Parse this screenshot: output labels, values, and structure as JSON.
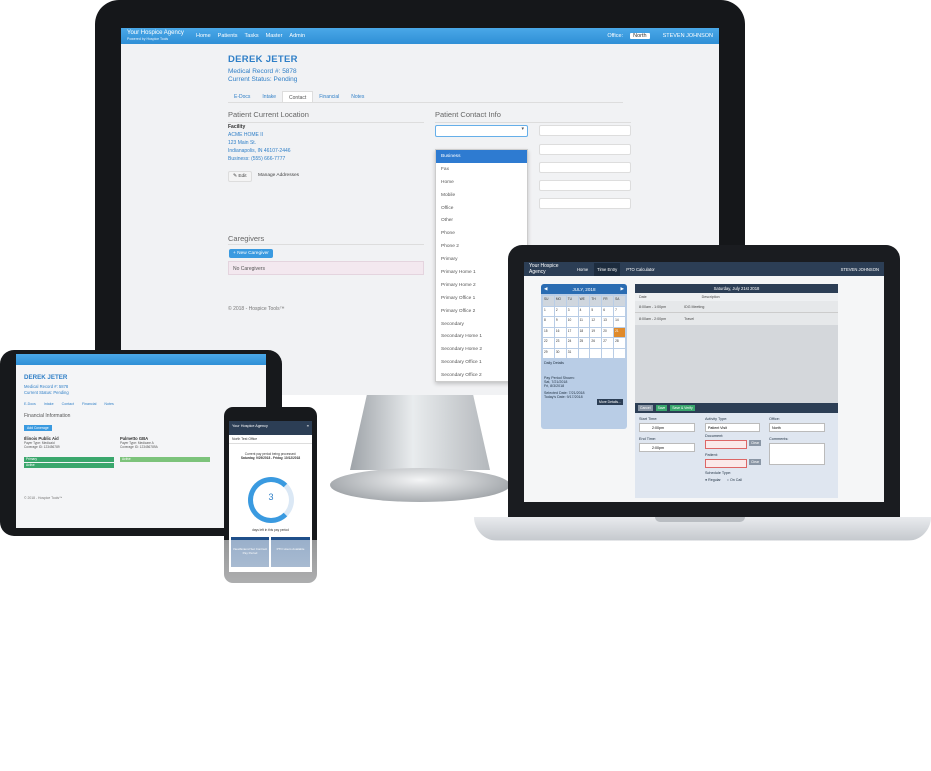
{
  "monitor": {
    "nav": {
      "brand": "Your Hospice Agency",
      "powered": "Powered by Hospice Tools",
      "home": "Home",
      "patients": "Patients",
      "tasks": "Tasks",
      "master": "Master",
      "admin": "Admin",
      "office_label": "Office:",
      "office_value": "North",
      "user": "STEVEN JOHNSON"
    },
    "patient_name": "DEREK JETER",
    "record": "Medical Record #: 5878",
    "status": "Current Status: Pending",
    "tabs": [
      "E-Docs",
      "Intake",
      "Contact",
      "Financial",
      "Notes"
    ],
    "location_title": "Patient Current Location",
    "facility_label": "Facility",
    "facility_lines": [
      "ACME HOME II",
      "123 Main St.",
      "Indianapolis, IN 46107-2446",
      "Business: (555) 666-7777"
    ],
    "edit": "Edit",
    "manage": "Manage Addresses",
    "contact_title": "Patient Contact Info",
    "phone_types": [
      "Business",
      "Fax",
      "Home",
      "Mobile",
      "Office",
      "Other",
      "Phone",
      "Phone 2",
      "Primary",
      "Primary Home 1",
      "Primary Home 2",
      "Primary Office 1",
      "Primary Office 2",
      "Secondary",
      "Secondary Home 1",
      "Secondary Home 2",
      "Secondary Office 1",
      "Secondary Office 2"
    ],
    "caregivers_title": "Caregivers",
    "new_caregiver": "New Caregiver",
    "no_caregivers": "No Caregivers",
    "footer": "© 2018 - Hospice Tools™"
  },
  "tablet": {
    "name": "DEREK JETER",
    "record": "Medical Record #: 5878",
    "status": "Current Status: Pending",
    "tabs": [
      "E-Docs",
      "Intake",
      "Contact",
      "Financial",
      "Notes"
    ],
    "section": "Financial Information",
    "add": "Add Coverage",
    "cards": [
      {
        "title": "Illinois Public Aid",
        "lines": [
          "Payer Type: Medicaid",
          "Coverage ID: 123456789"
        ],
        "bars": [
          "Primary",
          "Active"
        ]
      },
      {
        "title": "Palmetto GBA",
        "lines": [
          "Payer Type: Medicare A",
          "Coverage ID: 123456789A"
        ],
        "bars": [
          "Active"
        ]
      }
    ],
    "footer": "© 2018 - Hospice Tools™"
  },
  "phone": {
    "brand": "Your Hospice Agency",
    "office": "North Test Office",
    "period_text": "Current pay period being processed:",
    "period": "Saturday, 9/29/2018 - Friday, 10/12/2018",
    "days": "3",
    "days_label": "days left in this pay period",
    "btn1": "View/Extend Set Contract Pay Period",
    "btn2": "PTO Hours Available"
  },
  "laptop": {
    "brand": "Your Hospice Agency",
    "home": "Home",
    "time_entry": "Time Entry",
    "pto": "PTO Calculator",
    "user": "STEVEN JOHNSON",
    "month": "JULY, 2018",
    "weekdays": [
      "SU",
      "MO",
      "TU",
      "WE",
      "TH",
      "FR",
      "SA"
    ],
    "daily_details": "Daily Details",
    "pay_period_shown": "Pay Period Shown:",
    "pp_start": "Sat, 7/21/2018",
    "pp_end": "Fri, 8/3/2018",
    "more": "More Details...",
    "selected_date": "Selected Date: 7/21/2018",
    "todays_date": "Today's Date: 9/17/2018",
    "day_title": "Saturday, July 21st 2018",
    "col_date": "Date",
    "col_desc": "Description",
    "rows": [
      {
        "time": "8:00am - 1:00pm",
        "desc": "IDG Meeting"
      },
      {
        "time": "8:00am - 2:00pm",
        "desc": "Travel"
      }
    ],
    "cancel": "Cancel",
    "save": "Save",
    "save_verify": "Save & Verify",
    "start_label": "Start Time:",
    "start": "2:00pm",
    "end_label": "End Time:",
    "end": "2:00pm",
    "activity_label": "Activity Type:",
    "activity": "Patient Visit",
    "document_label": "Document:",
    "patient_label": "Patient:",
    "schedule_label": "Schedule Type:",
    "regular": "Regular",
    "oncall": "On Call",
    "office_label": "Office:",
    "office": "North",
    "comments_label": "Comments:",
    "clear": "Clear"
  }
}
